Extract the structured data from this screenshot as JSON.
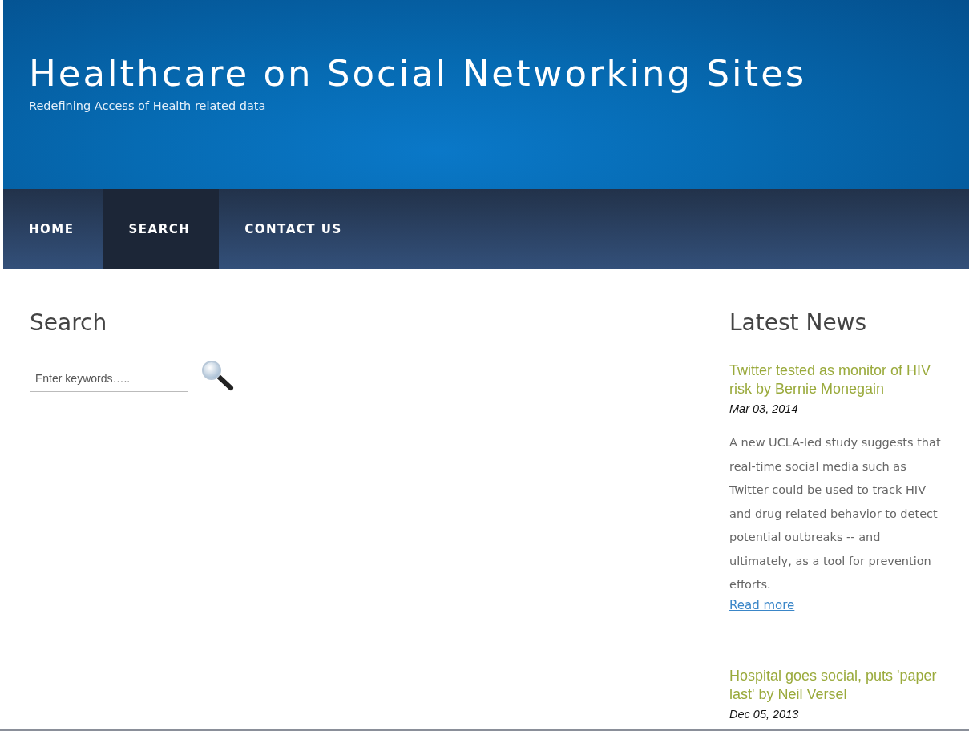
{
  "site": {
    "title": "Healthcare on Social Networking Sites",
    "tagline": "Redefining Access of Health related data"
  },
  "nav": [
    {
      "label": "HOME",
      "selected": false
    },
    {
      "label": "SEARCH",
      "selected": true
    },
    {
      "label": "CONTACT US",
      "selected": false
    }
  ],
  "search": {
    "heading": "Search",
    "placeholder": "Enter keywords….."
  },
  "news": {
    "heading": "Latest News",
    "items": [
      {
        "title": "Twitter tested as monitor of HIV risk by Bernie Monegain",
        "date": "Mar 03, 2014",
        "summary": "A new UCLA-led study suggests that real-time social media such as Twitter could be used to track HIV and drug related behavior to detect potential outbreaks -- and ultimately, as a tool for prevention efforts.",
        "link": "Read more"
      },
      {
        "title": "Hospital goes social, puts 'paper last' by Neil Versel",
        "date": "Dec 05, 2013"
      }
    ]
  }
}
